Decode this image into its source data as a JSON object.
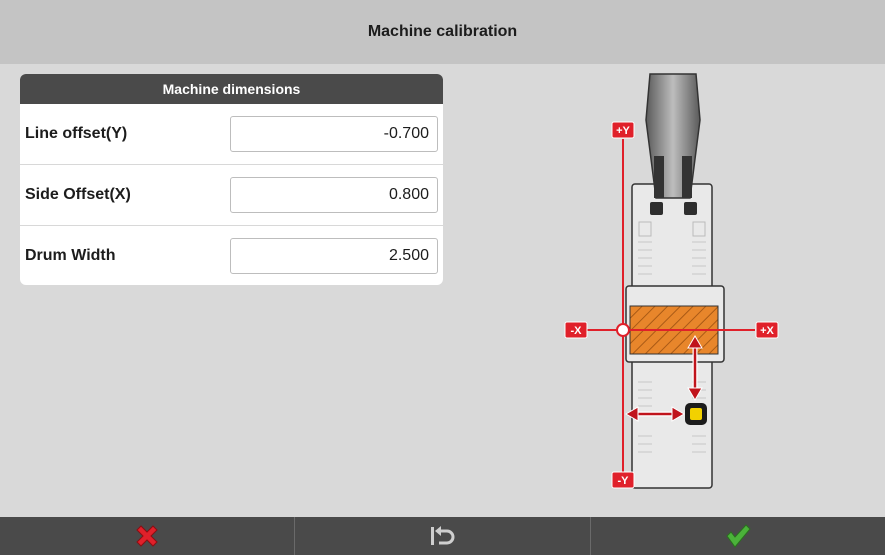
{
  "window": {
    "title": "Machine calibration"
  },
  "machine_dimensions": {
    "header": "Machine dimensions",
    "fields": [
      {
        "label": "Line offset(Y)",
        "value": "-0.700"
      },
      {
        "label": "Side Offset(X)",
        "value": "0.800"
      },
      {
        "label": "Drum Width",
        "value": "2.500"
      }
    ]
  },
  "diagram": {
    "axis_labels": {
      "plus_y": "+Y",
      "minus_y": "-Y",
      "plus_x": "+X",
      "minus_x": "-X"
    },
    "colors": {
      "axis": "#e0202a",
      "drum": "#e8862b",
      "sensor": "#f2d100",
      "body": "#e9e9e9"
    }
  },
  "toolbar": {
    "buttons": [
      {
        "name": "cancel",
        "icon": "x-icon",
        "color": "#e0202a"
      },
      {
        "name": "reset",
        "icon": "undo-icon",
        "color": "#cfcfcf"
      },
      {
        "name": "confirm",
        "icon": "check-icon",
        "color": "#4bb23a"
      }
    ]
  }
}
